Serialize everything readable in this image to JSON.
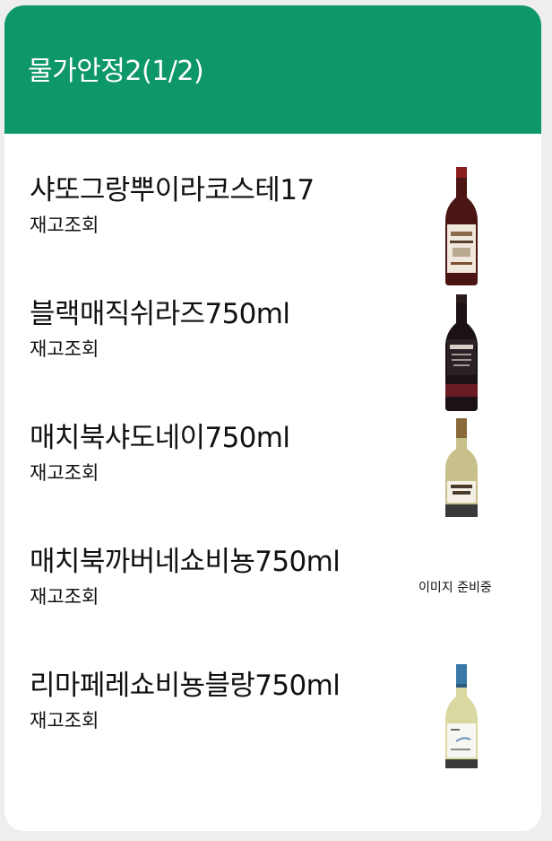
{
  "header": {
    "title": "물가안정2(1/2)",
    "color": "#0e9767"
  },
  "items": [
    {
      "name": "샤또그랑뿌이라코스테17",
      "link": "재고조회",
      "image": "red-wine-bottle-with-label"
    },
    {
      "name": "블랙매직쉬라즈750ml",
      "link": "재고조회",
      "image": "dark-wine-bottle"
    },
    {
      "name": "매치북샤도네이750ml",
      "link": "재고조회",
      "image": "white-wine-bottle"
    },
    {
      "name": "매치북까버네쇼비뇽750ml",
      "link": "재고조회",
      "image_placeholder": "이미지 준비중"
    },
    {
      "name": "리마페레쇼비뇽블랑750ml",
      "link": "재고조회",
      "image": "white-wine-bottle-blue-cap"
    }
  ]
}
